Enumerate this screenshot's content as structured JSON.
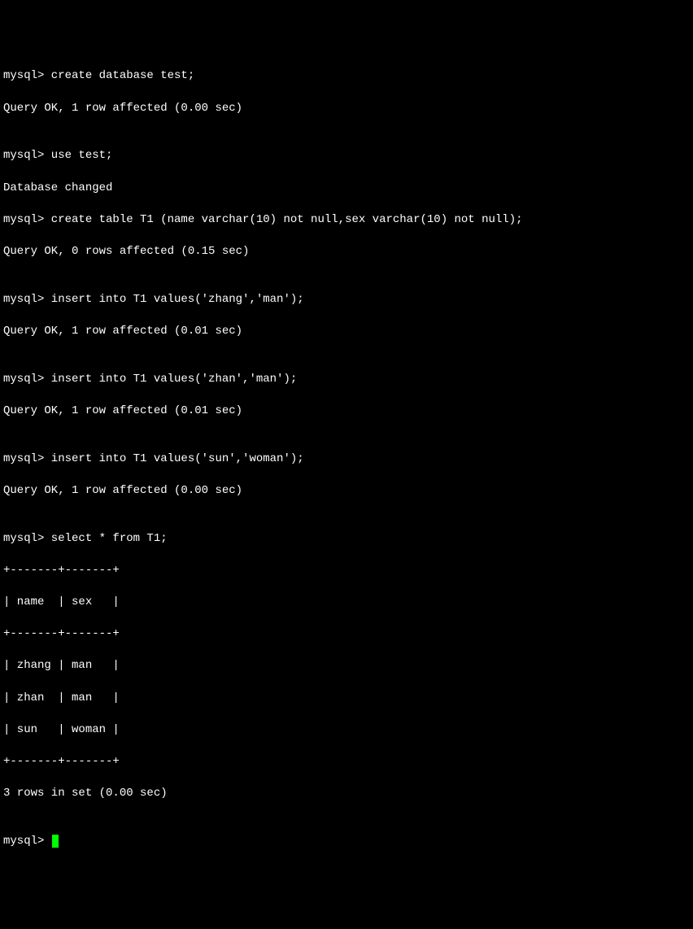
{
  "prompt": "mysql>",
  "lines": {
    "l1": "mysql> create database test;",
    "l2": "Query OK, 1 row affected (0.00 sec)",
    "l3": "",
    "l4": "mysql> use test;",
    "l5": "Database changed",
    "l6": "mysql> create table T1 (name varchar(10) not null,sex varchar(10) not null);",
    "l7": "Query OK, 0 rows affected (0.15 sec)",
    "l8": "",
    "l9": "mysql> insert into T1 values('zhang','man');",
    "l10": "Query OK, 1 row affected (0.01 sec)",
    "l11": "",
    "l12": "mysql> insert into T1 values('zhan','man');",
    "l13": "Query OK, 1 row affected (0.01 sec)",
    "l14": "",
    "l15": "mysql> insert into T1 values('sun','woman');",
    "l16": "Query OK, 1 row affected (0.00 sec)",
    "l17": "",
    "l18": "mysql> select * from T1;",
    "l19": "+-------+-------+",
    "l20": "| name  | sex   |",
    "l21": "+-------+-------+",
    "l22": "| zhang | man   |",
    "l23": "| zhan  | man   |",
    "l24": "| sun   | woman |",
    "l25": "+-------+-------+",
    "l26": "3 rows in set (0.00 sec)",
    "l27": "",
    "l28": "mysql> "
  }
}
